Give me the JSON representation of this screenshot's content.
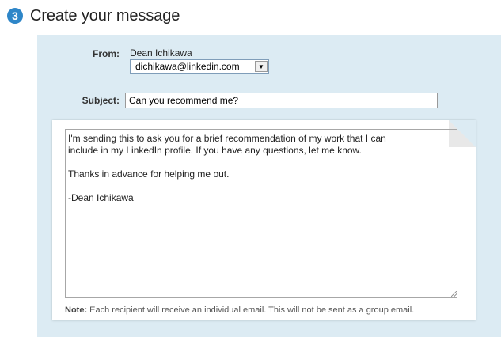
{
  "step": {
    "number": "3",
    "title": "Create your message"
  },
  "form": {
    "from_label": "From:",
    "from_name": "Dean Ichikawa",
    "from_email_selected": "dichikawa@linkedin.com",
    "subject_label": "Subject:",
    "subject_value": "Can you recommend me?",
    "message_body": "I'm sending this to ask you for a brief recommendation of my work that I can\ninclude in my LinkedIn profile. If you have any questions, let me know.\n\nThanks in advance for helping me out.\n\n-Dean Ichikawa",
    "note_label": "Note:",
    "note_text": " Each recipient will receive an individual email. This will not be sent as a group email."
  },
  "icons": {
    "step_badge": "numbered-circle-icon",
    "dropdown": "triangle-down-icon",
    "resize": "resize-grip-icon",
    "page_fold": "folded-corner-icon"
  },
  "colors": {
    "accent": "#2e86c8",
    "panel_background": "#dcebf3"
  }
}
